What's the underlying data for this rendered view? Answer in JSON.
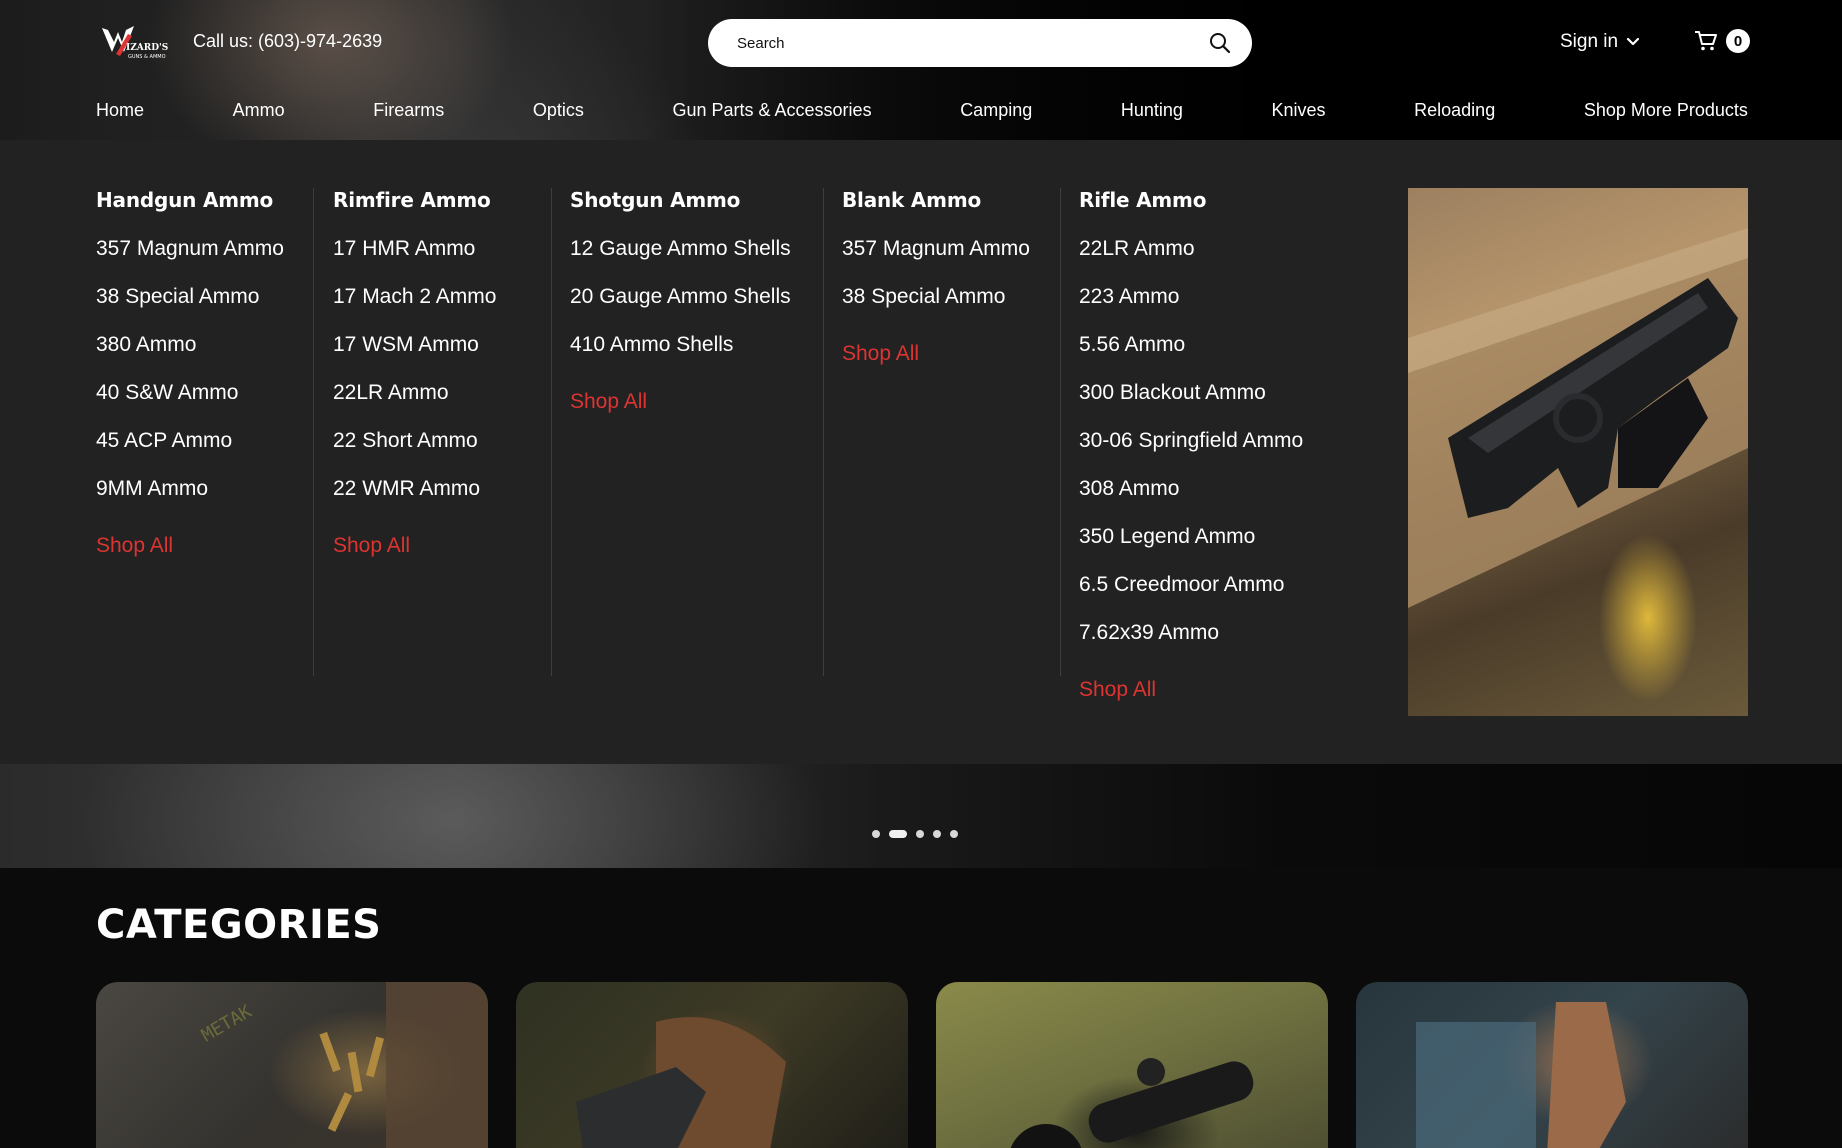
{
  "header": {
    "logo_alt": "WIZARD'S GUNS & AMMO",
    "call_text": "Call us: (603)-974-2639",
    "search_placeholder": "Search",
    "signin_label": "Sign in",
    "cart_count": "0"
  },
  "nav": [
    "Home",
    "Ammo",
    "Firearms",
    "Optics",
    "Gun Parts & Accessories",
    "Camping",
    "Hunting",
    "Knives",
    "Reloading",
    "Shop More Products"
  ],
  "mega_menu": {
    "columns": [
      {
        "title": "Handgun Ammo",
        "items": [
          "357 Magnum Ammo",
          "38 Special Ammo",
          "380 Ammo",
          "40 S&W Ammo",
          "45 ACP Ammo",
          "9MM Ammo"
        ],
        "shop_all": "Shop All"
      },
      {
        "title": "Rimfire Ammo",
        "items": [
          "17 HMR Ammo",
          "17 Mach 2 Ammo",
          "17 WSM Ammo",
          "22LR Ammo",
          "22 Short Ammo",
          "22 WMR Ammo"
        ],
        "shop_all": "Shop All"
      },
      {
        "title": "Shotgun Ammo",
        "items": [
          "12 Gauge Ammo Shells",
          "20 Gauge Ammo Shells",
          "410 Ammo Shells"
        ],
        "shop_all": "Shop All"
      },
      {
        "title": "Blank Ammo",
        "items": [
          "357 Magnum Ammo",
          "38 Special Ammo"
        ],
        "shop_all": "Shop All"
      },
      {
        "title": "Rifle Ammo",
        "items": [
          "22LR Ammo",
          "223 Ammo",
          "5.56 Ammo",
          "300 Blackout Ammo",
          "30-06 Springfield Ammo",
          "308 Ammo",
          "350 Legend Ammo",
          "6.5 Creedmoor Ammo",
          "7.62x39 Ammo"
        ],
        "shop_all": "Shop All"
      }
    ]
  },
  "hero": {
    "slide_count": 5,
    "active_slide": 2
  },
  "categories": {
    "title": "CATEGORIES"
  },
  "colors": {
    "accent_red": "#dc3531",
    "menu_bg": "#222223",
    "page_bg": "#0b0b0b"
  }
}
